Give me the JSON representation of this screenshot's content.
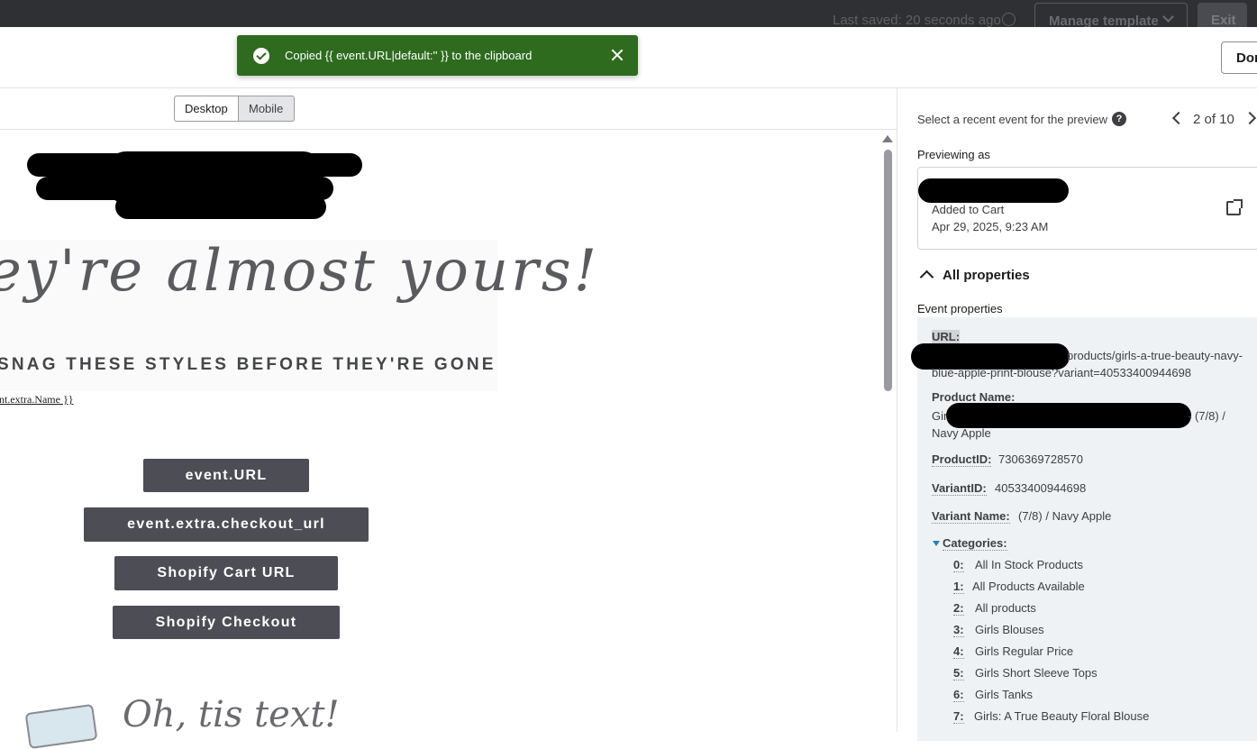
{
  "topbar": {
    "last_saved": "Last saved: 20 seconds ago",
    "manage_template": "Manage template",
    "exit": "Exit"
  },
  "header": {
    "done": "Don"
  },
  "toast": {
    "message": "Copied {{ event.URL|default:'' }} to the clipboard"
  },
  "preview": {
    "device_desktop": "Desktop",
    "device_mobile": "Mobile",
    "hero_script": "ey're almost yours!",
    "hero_tagline": "SNAG THESE STYLES BEFORE THEY'RE GONE",
    "extra_name_tag": "nt.extra.Name }}",
    "buttons": [
      "event.URL",
      "event.extra.checkout_url",
      "Shopify Cart URL",
      "Shopify Checkout"
    ],
    "footer_script": "Oh, tis text!"
  },
  "panel": {
    "select_event_label": "Select a recent event for the preview",
    "help": "?",
    "pager": "2 of 10",
    "previewing_as": "Previewing as",
    "event_type": "Added to Cart",
    "event_date": "Apr 29, 2025, 9:23 AM",
    "all_properties": "All properties",
    "event_properties": "Event properties",
    "url_key": "URL:",
    "url_value_line1": "products/girls-a-true-beauty-navy-",
    "url_value_line2": "blue-apple-print-blouse?variant=40533400944698",
    "product_name_key": "Product Name:",
    "product_name_prefix": "Gir",
    "product_name_suffix": "- (7/8) /",
    "product_name_line2": "Navy Apple",
    "product_id_key": "ProductID:",
    "product_id_value": "7306369728570",
    "variant_id_key": "VariantID:",
    "variant_id_value": "40533400944698",
    "variant_name_key": "Variant Name:",
    "variant_name_value": "(7/8) / Navy Apple",
    "categories_key": "Categories:",
    "categories": [
      {
        "idx": "0:",
        "value": "All In Stock Products"
      },
      {
        "idx": "1:",
        "value": "All Products Available"
      },
      {
        "idx": "2:",
        "value": "All products"
      },
      {
        "idx": "3:",
        "value": "Girls Blouses"
      },
      {
        "idx": "4:",
        "value": "Girls Regular Price"
      },
      {
        "idx": "5:",
        "value": "Girls Short Sleeve Tops"
      },
      {
        "idx": "6:",
        "value": "Girls Tanks"
      },
      {
        "idx": "7:",
        "value": "Girls: A True Beauty Floral Blouse"
      }
    ]
  }
}
